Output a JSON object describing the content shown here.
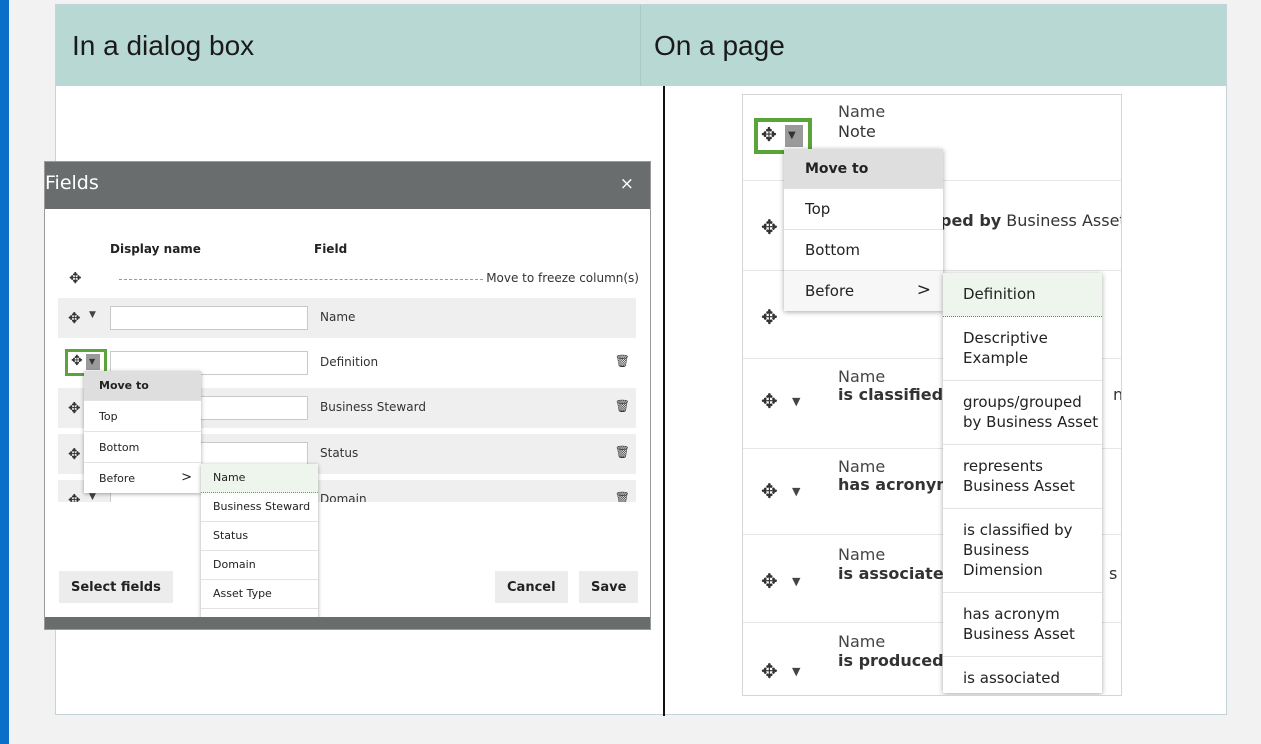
{
  "headers": {
    "col1": "In a dialog box",
    "col2": "On a page"
  },
  "dialog": {
    "title": "Fields",
    "close": "×",
    "col_display_name": "Display name",
    "col_field": "Field",
    "freeze_label": "Move to freeze column(s)",
    "rows": [
      {
        "field": "Name"
      },
      {
        "field": "Definition"
      },
      {
        "field": "Business Steward"
      },
      {
        "field": "Status"
      },
      {
        "field": "Domain"
      }
    ],
    "menu": {
      "title": "Move to",
      "top": "Top",
      "bottom": "Bottom",
      "before": "Before",
      "arrow": ">"
    },
    "submenu": [
      "Name",
      "Business Steward",
      "Status",
      "Domain",
      "Asset Type"
    ],
    "select_fields": "Select fields",
    "cancel": "Cancel",
    "save": "Save"
  },
  "page": {
    "row1": {
      "name": "Name",
      "value": "Note"
    },
    "row2": {
      "tail_bold": "ped by",
      "tail": " Business Asset"
    },
    "row3": {
      "name": "Name",
      "bold": "is classified b",
      "tail": "n"
    },
    "row4": {
      "name": "Name",
      "bold": "has acronym"
    },
    "row5": {
      "name": "Name",
      "bold": "is associated",
      "tail": "s"
    },
    "row6": {
      "name": "Name",
      "bold": "is produced b"
    },
    "menu": {
      "title": "Move to",
      "top": "Top",
      "bottom": "Bottom",
      "before": "Before",
      "arrow": ">"
    },
    "submenu": [
      "Definition",
      "Descriptive Example",
      "groups/grouped by Business Asset",
      "represents Business Asset",
      "is classified by Business Dimension",
      "has acronym Business Asset",
      "is associated"
    ]
  },
  "icons": {
    "move": "move-icon",
    "caret": "caret-down-icon",
    "trash": "trash-icon"
  }
}
